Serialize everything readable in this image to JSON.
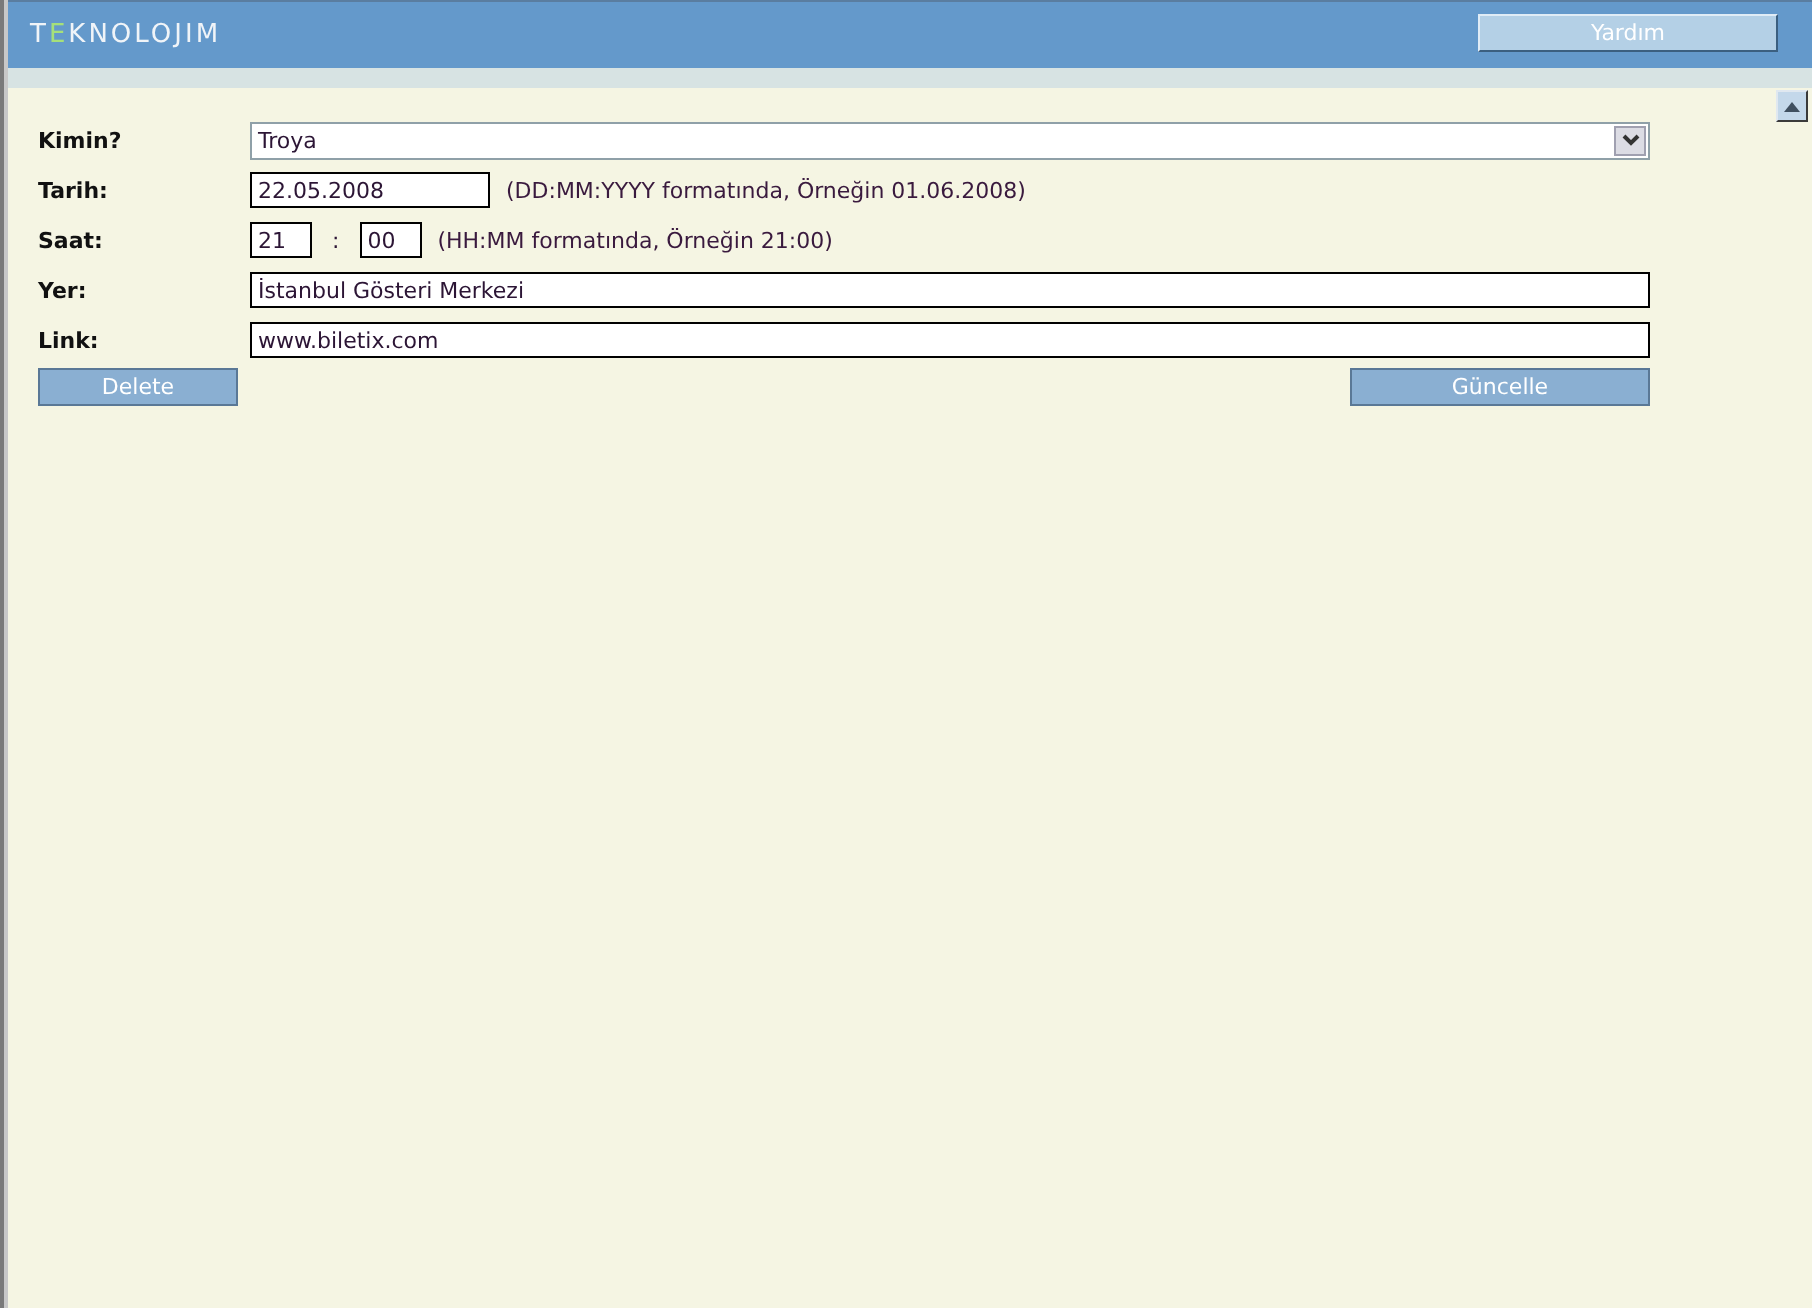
{
  "header": {
    "logo": [
      {
        "text": "T",
        "accent": false
      },
      {
        "text": "E",
        "accent": true
      },
      {
        "text": "KNOLOJIM",
        "accent": false
      }
    ],
    "help_button": "Yardım"
  },
  "form": {
    "rows": [
      {
        "kind": "select",
        "label": "Kimin?",
        "value": "Troya"
      },
      {
        "kind": "date",
        "label": "Tarih:",
        "value": "22.05.2008",
        "hint": "(DD:MM:YYYY formatında, Örneğin 01.06.2008)"
      },
      {
        "kind": "time",
        "label": "Saat:",
        "hours": "21",
        "separator": ":",
        "minutes": "00",
        "hint": "(HH:MM formatında, Örneğin 21:00)"
      },
      {
        "kind": "text",
        "label": "Yer:",
        "value": "İstanbul Gösteri Merkezi"
      },
      {
        "kind": "text",
        "label": "Link:",
        "value": "www.biletix.com"
      }
    ],
    "delete_button": "Delete",
    "update_button": "Güncelle"
  }
}
